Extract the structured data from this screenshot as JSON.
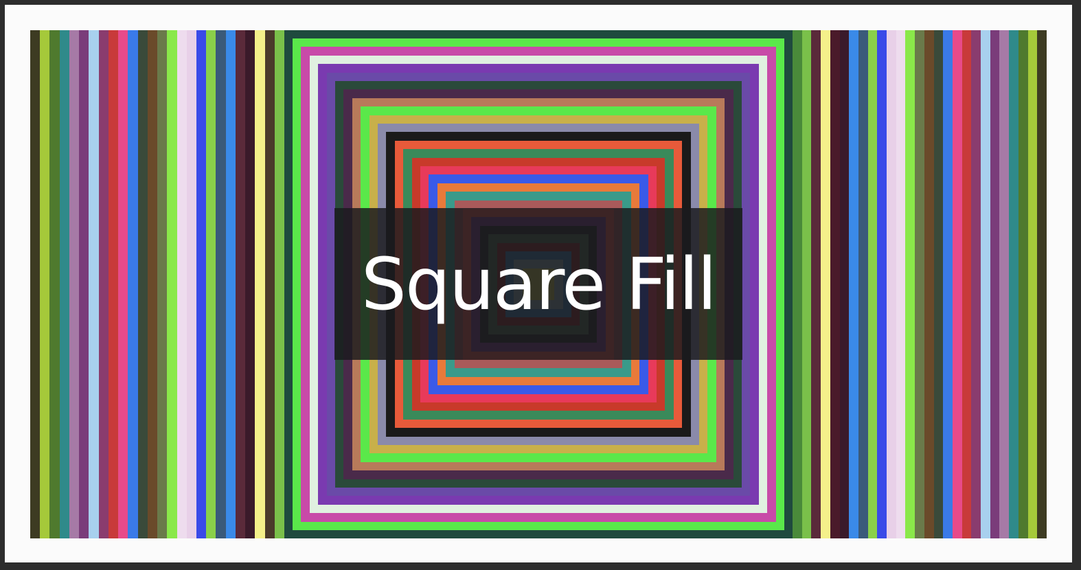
{
  "title": "Square Fill",
  "colors": {
    "outer_border": "#2d2d2d",
    "frame": "#fbfbfb",
    "overlay": "#1a1a1e"
  },
  "left_stripes": [
    "#3d3b22",
    "#a5c93a",
    "#4f7a2e",
    "#2f8a8a",
    "#a67aa6",
    "#7a3c7a",
    "#a8d0ee",
    "#8a3c6e",
    "#c83a3a",
    "#e84a8a",
    "#3a7ae8",
    "#3a4a3a",
    "#6a4a2a",
    "#6a7a4a",
    "#8ae84a",
    "#eedcee",
    "#e8d0e8",
    "#3a4ae8",
    "#8ad04a",
    "#3a5a7a",
    "#3a8ae8",
    "#5a2a3a",
    "#3a1a2a",
    "#f4f08a",
    "#4a3a2a",
    "#7ac04a"
  ],
  "right_stripes": [
    "#4a8a3a",
    "#7ac04a",
    "#5a2a3a",
    "#f4f08a",
    "#4a1a2a",
    "#3a1a2a",
    "#3a8ae8",
    "#3a5a7a",
    "#8ad04a",
    "#3a4ae8",
    "#e8d0e8",
    "#eedcee",
    "#8ae84a",
    "#6a7a4a",
    "#6a4a2a",
    "#3a4a3a",
    "#3a7ae8",
    "#e84a8a",
    "#c83a3a",
    "#8a3c6e",
    "#a8d0ee",
    "#7a3c7a",
    "#a67aa6",
    "#2f8a8a",
    "#4f7a2e",
    "#a5c93a",
    "#3d3b22"
  ],
  "square_rings": [
    "#5ae84a",
    "#c84aa8",
    "#e0f0e0",
    "#7a3ab0",
    "#6a4aa8",
    "#2a4a3a",
    "#4a2a4a",
    "#b87a5a",
    "#5ae84a",
    "#c8b04a",
    "#8a8aaa",
    "#1a1a1a",
    "#e85a3a",
    "#3a8a5a",
    "#c83a2a",
    "#e83a5a",
    "#3a5ae8",
    "#e87a3a",
    "#3a9a8a",
    "#aa5a5a",
    "#e85a4a",
    "#7a3a8a",
    "#2a2a2a",
    "#4a6a4a",
    "#8a2a2a",
    "#3a7ab0",
    "#8aaab0",
    "#c0c04a"
  ]
}
